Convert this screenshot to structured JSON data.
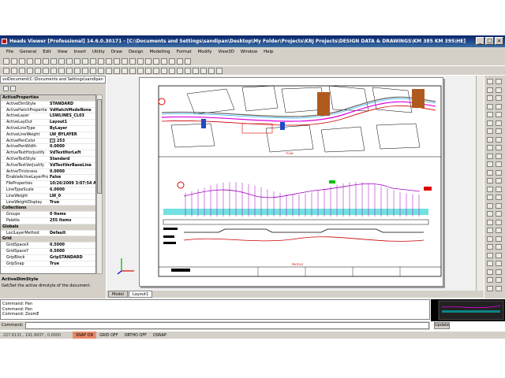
{
  "window": {
    "title": "Heads Viewer [Professional] 14.6.0.30171 - [C:\\Documents and Settings\\sandipan\\Desktop\\My Folder\\Projects\\KBJ Projects\\DESIGN DATA & DRAWINGS\\KM 385 KM 395\\HE]",
    "minimize": "_",
    "restore": "□",
    "close": "×"
  },
  "menu": [
    "File",
    "General",
    "Edit",
    "View",
    "Insert",
    "Utility",
    "Draw",
    "Design",
    "Modelling",
    "Format",
    "Modify",
    "View3D",
    "Window",
    "Help"
  ],
  "doc_path": "vsiDocument(C:\\Documents and Settings\\sandipan",
  "properties": [
    {
      "section": "ActiveProperties"
    },
    {
      "name": "ActiveDimStyle",
      "value": "STANDARD"
    },
    {
      "name": "ActiveHatchPropertie",
      "value": "VdHatchModeNone"
    },
    {
      "name": "ActiveLayer",
      "value": "LSWLINES_CL03"
    },
    {
      "name": "ActiveLayOut",
      "value": "Layout1"
    },
    {
      "name": "ActiveLineType",
      "value": "ByLayer"
    },
    {
      "name": "ActiveLineWeight",
      "value": "LW_BYLAYER"
    },
    {
      "name": "ActivePenColor",
      "value": "253",
      "swatch": true
    },
    {
      "name": "ActivePenWidth",
      "value": "0.0000"
    },
    {
      "name": "ActiveTextHorJustify",
      "value": "VdTextHorLeft"
    },
    {
      "name": "ActiveTextStyle",
      "value": "Standard"
    },
    {
      "name": "ActiveTextVerJustify",
      "value": "VdTextVerBaseLine"
    },
    {
      "name": "ActiveThickness",
      "value": "0.0000"
    },
    {
      "name": "EnableActiveLayerPro",
      "value": "False"
    },
    {
      "name": "FileProperties",
      "value": "10/26/2009 3:07:54 AM"
    },
    {
      "name": "LineTypeScale",
      "value": "6.0000"
    },
    {
      "name": "LineWeight",
      "value": "LW_0"
    },
    {
      "name": "LineWeightDisplay",
      "value": "True"
    },
    {
      "section": "Collections"
    },
    {
      "name": "Groups",
      "value": "0 Items"
    },
    {
      "name": "Palette",
      "value": "255 Items"
    },
    {
      "section": "Globals"
    },
    {
      "name": "LoclLayerMethod",
      "value": "Default"
    },
    {
      "section": "Grid"
    },
    {
      "name": "GridSpaceX",
      "value": "0.5000"
    },
    {
      "name": "GridSpaceY",
      "value": "0.5000"
    },
    {
      "name": "GripBlock",
      "value": "GripSTANDARD"
    },
    {
      "name": "GripSnap",
      "value": "True"
    }
  ],
  "description": {
    "heading": "ActiveDimStyle",
    "text": "Get/Set the active dimstyle of the document."
  },
  "tabs": [
    "Model",
    "Layout1"
  ],
  "drawing": {
    "plan_label": "PLAN",
    "profile_label": "PROFILE"
  },
  "command_history": [
    "Command: Pan",
    "Command: Pan",
    "Command: ZoomE"
  ],
  "command_label": "Command:",
  "update_label": "Update",
  "status": {
    "coords": "227.6131 , 191.9937 , 0.0000",
    "snap": "SNAP ON",
    "grid": "GRID OFF",
    "ortho": "ORTHO OFF",
    "osnap": "OSNAP"
  },
  "colors": {
    "title_bar": "#0a246a",
    "snap_on": "#e98a6a",
    "road_alignment": "#e000e0",
    "profile_band": "#00c8c8"
  }
}
